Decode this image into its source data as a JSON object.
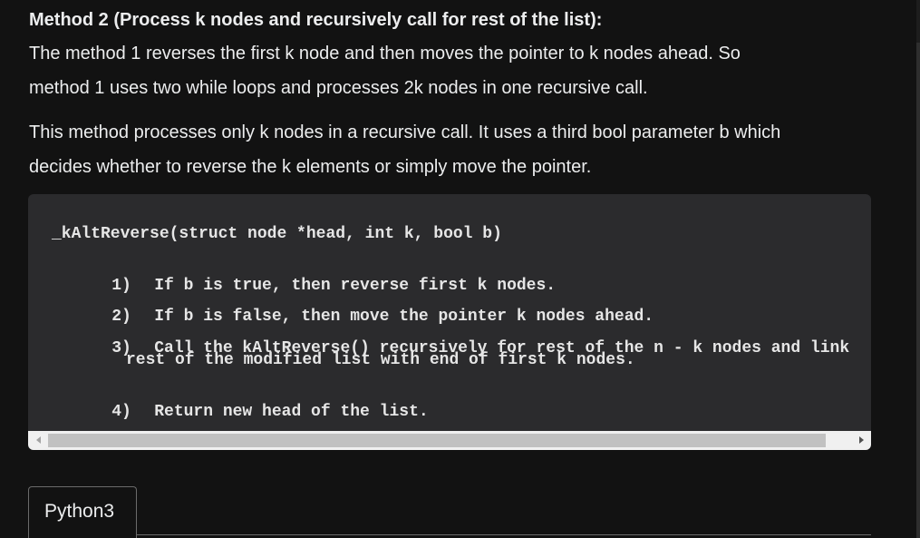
{
  "heading": "Method 2 (Process k nodes and recursively call for rest of the list):",
  "paragraphs": {
    "p1_line1": "The method 1 reverses the first k node and then moves the pointer to k nodes ahead. So",
    "p1_line2": "method 1 uses two while loops and processes 2k nodes in one recursive call.",
    "p2_line1": "This method processes only k nodes in a recursive call. It uses a third bool parameter b which",
    "p2_line2": "decides whether to reverse the k elements or simply move the pointer."
  },
  "code": {
    "signature": "_kAltReverse(struct node *head, int k, bool b)",
    "steps": [
      {
        "num": "1)",
        "text": "If b is true, then reverse first k nodes."
      },
      {
        "num": "2)",
        "text": "If b is false, then move the pointer k nodes ahead."
      },
      {
        "num": "3)",
        "text": "Call the kAltReverse() recursively for rest of the n - k nodes and link"
      },
      {
        "num": "4)",
        "text": "Return new head of the list."
      }
    ],
    "step3_continuation": "rest of the modified list with end of first k nodes."
  },
  "tabs": [
    {
      "label": "Python3"
    }
  ],
  "colors": {
    "page_background": "#121212",
    "code_background": "#2b2b2d",
    "text": "#ecedee"
  }
}
